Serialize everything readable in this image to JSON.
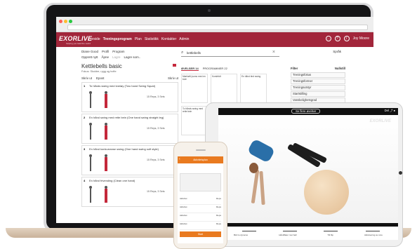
{
  "colors": {
    "brand": "#a2263b",
    "accent_orange": "#e97a1f"
  },
  "laptop": {
    "nav": {
      "logo": "EXORLIVE",
      "logo_sub": "helping you lead the world",
      "links": [
        "Forside",
        "Treningsprogram",
        "Plan",
        "Statistikk",
        "Kontakter",
        "Admin"
      ],
      "user": "Joy Moore"
    },
    "userbar": [
      "Diane Good",
      "Profil",
      "Program"
    ],
    "language": "Språk",
    "toolbar": [
      "Opprett nytt",
      "Åpne",
      "Lagre",
      "Lagre som.."
    ],
    "program": {
      "title": "Kettlebells basic",
      "focus": "Fokus: Skuldre, rygg og hofte",
      "actions": [
        "Skriv ut",
        "Epost",
        "Skriv ut"
      ],
      "exercises": [
        {
          "num": "1",
          "title": "To hånds swing med kneløy (Two hand Swing Squat)",
          "meta": "15 Reps, 3 Sets"
        },
        {
          "num": "2",
          "title": "En hånd swing med rette bein (One hand swing straight leg)",
          "meta": "15 Reps, 3 Sets"
        },
        {
          "num": "3",
          "title": "En hånd konkurranse swing (One hand swing soft style)",
          "meta": "15 Reps, 3 Sets"
        },
        {
          "num": "4",
          "title": "En hånd frivending (Clean one hand)",
          "meta": "15 Reps, 3 Sets"
        }
      ]
    },
    "search": {
      "query": "kettlebells",
      "tab_exercises": "ØVELSER 14",
      "tab_programs": "PROGRAMMER 22",
      "results": [
        "Markløft (sumo med en kule",
        "Korsfeldt",
        "En hånd bird swing",
        "To hånds swing med rette bein"
      ]
    },
    "filter": {
      "title": "Filter",
      "reset": "Nullstill",
      "rows": [
        "Treningsfokus",
        "Treningsformer",
        "Treningsutstyr",
        "Startstilling",
        "Vanskelighetsgrad",
        "Aldersgruppe"
      ]
    }
  },
  "tablet": {
    "button": "Se flere øvelser",
    "share": "Del",
    "watermark": "EXORLIVE",
    "captions": [
      "Bird to dynamo",
      "Håndflater mot ball",
      "Tilt flip",
      "Aktivisering av core"
    ]
  },
  "phone": {
    "title": "Aktivitetsplan",
    "cta": "Start",
    "rows": [
      {
        "label": "Aktivitet",
        "value": "Reps"
      },
      {
        "label": "Aktivitet",
        "value": "Reps"
      },
      {
        "label": "Aktivitet",
        "value": "Reps"
      },
      {
        "label": "Aktivitet",
        "value": "Reps"
      }
    ]
  }
}
